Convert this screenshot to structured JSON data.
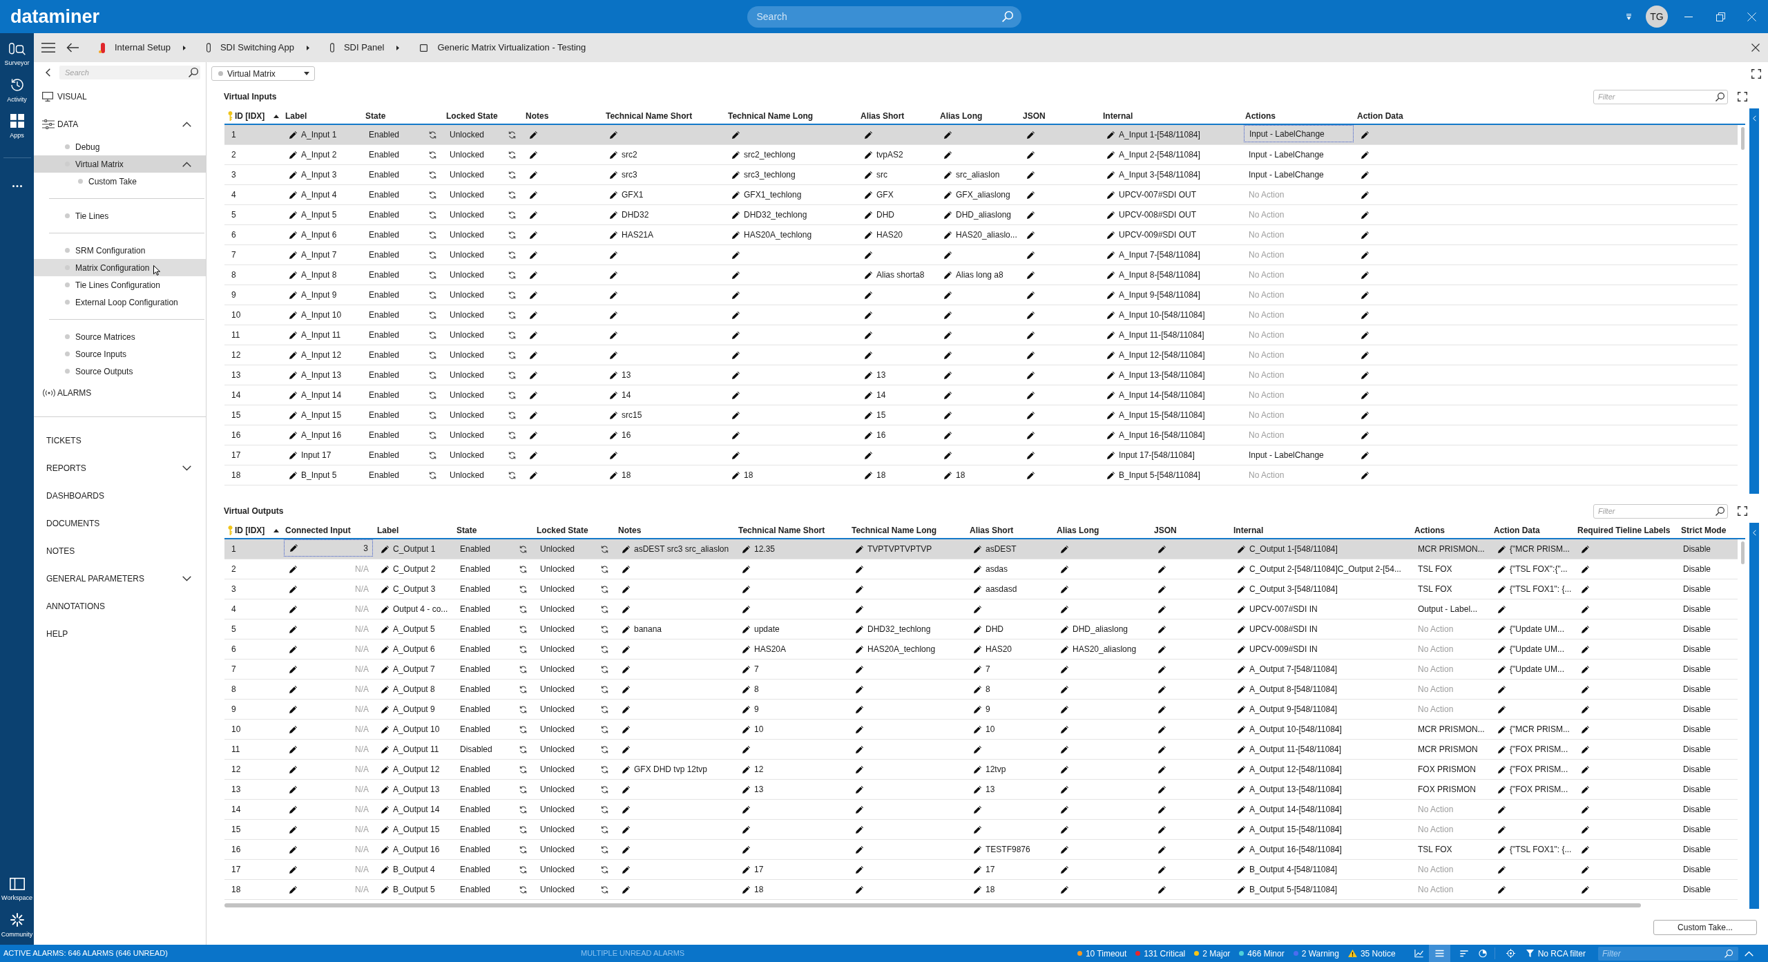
{
  "top_bar": {
    "logo": "dataminer",
    "search": {
      "placeholder": "Search"
    },
    "user": {
      "initials": "TG"
    }
  },
  "rail": {
    "items": [
      {
        "label": "Surveyor"
      },
      {
        "label": "Activity"
      },
      {
        "label": "Apps"
      }
    ],
    "bottom_items": [
      {
        "label": "Workspace"
      },
      {
        "label": "Community"
      }
    ]
  },
  "breadcrumb": [
    {
      "label": "Internal Setup",
      "kind": "view",
      "color": "#e0262b"
    },
    {
      "label": "SDI Switching App",
      "kind": "view"
    },
    {
      "label": "SDI Panel",
      "kind": "view"
    },
    {
      "label": "Generic Matrix Virtualization - Testing",
      "kind": "card"
    }
  ],
  "nav": {
    "search": {
      "placeholder": "Search"
    },
    "modules": [
      {
        "label": "VISUAL",
        "kind": "visual"
      },
      {
        "label": "DATA",
        "kind": "data",
        "expanded": true,
        "groups": [
          {
            "children": [
              {
                "label": "Debug",
                "selected": false,
                "hovered": false
              },
              {
                "label": "Virtual Matrix",
                "selected": true,
                "hovered": false,
                "expanded": true,
                "children": [
                  {
                    "label": "Custom Take",
                    "selected": false,
                    "hovered": false
                  }
                ]
              }
            ]
          },
          {
            "children": [
              {
                "label": "Tie Lines",
                "selected": false,
                "hovered": false
              }
            ]
          },
          {
            "children": [
              {
                "label": "SRM Configuration",
                "selected": false,
                "hovered": false
              },
              {
                "label": "Matrix Configuration",
                "selected": false,
                "hovered": true
              },
              {
                "label": "Tie Lines Configuration",
                "selected": false,
                "hovered": false
              },
              {
                "label": "External Loop Configuration",
                "selected": false,
                "hovered": false
              }
            ]
          },
          {
            "children": [
              {
                "label": "Source Matrices",
                "selected": false,
                "hovered": false
              },
              {
                "label": "Source Inputs",
                "selected": false,
                "hovered": false
              },
              {
                "label": "Source Outputs",
                "selected": false,
                "hovered": false
              }
            ]
          }
        ]
      },
      {
        "label": "ALARMS",
        "kind": "alarms"
      }
    ],
    "apps": [
      {
        "label": "TICKETS",
        "kind": "link"
      },
      {
        "label": "REPORTS",
        "kind": "menu",
        "expanded": false
      },
      {
        "label": "DASHBOARDS",
        "kind": "link"
      },
      {
        "label": "DOCUMENTS",
        "kind": "link"
      },
      {
        "label": "NOTES",
        "kind": "link"
      },
      {
        "label": "GENERAL PARAMETERS",
        "kind": "menu",
        "expanded": false
      },
      {
        "label": "ANNOTATIONS",
        "kind": "link"
      },
      {
        "label": "HELP",
        "kind": "link"
      }
    ]
  },
  "view_selector": {
    "value": "Virtual Matrix"
  },
  "tables": [
    {
      "title": "Virtual Inputs",
      "filter": {
        "placeholder": "Filter"
      },
      "columns": [
        {
          "label": "ID [IDX]",
          "kind": "key",
          "sorted": true,
          "focused": false
        },
        {
          "label": "Label",
          "kind": "edit",
          "sorted": false,
          "focused": false
        },
        {
          "label": "State",
          "kind": "toggle",
          "sorted": false,
          "focused": false
        },
        {
          "label": "Locked State",
          "kind": "toggle",
          "sorted": false,
          "focused": false
        },
        {
          "label": "Notes",
          "kind": "edit",
          "sorted": false,
          "focused": false
        },
        {
          "label": "Technical Name Short",
          "kind": "edit",
          "sorted": false,
          "focused": false
        },
        {
          "label": "Technical Name Long",
          "kind": "edit",
          "sorted": false,
          "focused": false
        },
        {
          "label": "Alias Short",
          "kind": "edit",
          "sorted": false,
          "focused": false
        },
        {
          "label": "Alias Long",
          "kind": "edit",
          "sorted": false,
          "focused": false
        },
        {
          "label": "JSON",
          "kind": "edit",
          "sorted": false,
          "focused": false
        },
        {
          "label": "Internal",
          "kind": "edit",
          "sorted": false,
          "focused": false
        },
        {
          "label": "Actions",
          "kind": "action",
          "sorted": false,
          "focused": true
        },
        {
          "label": "Action Data",
          "kind": "edit",
          "sorted": false,
          "focused": false
        }
      ],
      "rows": [
        {
          "id": "1",
          "label": "A_Input 1",
          "state": "Enabled",
          "locked_state": "Unlocked",
          "internal": "A_Input 1-[548/11084]",
          "actions": {
            "text": "Input - LabelChange",
            "dimmed": false
          },
          "selected": true
        },
        {
          "id": "2",
          "label": "A_Input 2",
          "state": "Enabled",
          "locked_state": "Unlocked",
          "tech_short": "src2",
          "tech_long": "src2_techlong",
          "alias_short": "tvpAS2",
          "internal": "A_Input 2-[548/11084]",
          "actions": {
            "text": "Input - LabelChange",
            "dimmed": false
          },
          "selected": false
        },
        {
          "id": "3",
          "label": "A_Input 3",
          "state": "Enabled",
          "locked_state": "Unlocked",
          "tech_short": "src3",
          "tech_long": "src3_techlong",
          "alias_short": "src",
          "alias_long": "src_aliaslon",
          "internal": "A_Input 3-[548/11084]",
          "actions": {
            "text": "Input - LabelChange",
            "dimmed": false
          },
          "selected": false
        },
        {
          "id": "4",
          "label": "A_Input 4",
          "state": "Enabled",
          "locked_state": "Unlocked",
          "tech_short": "GFX1",
          "tech_long": "GFX1_techlong",
          "alias_short": "GFX",
          "alias_long": "GFX_aliaslong",
          "internal": "UPCV-007#SDI OUT",
          "actions": {
            "text": "No Action",
            "dimmed": true
          },
          "selected": false
        },
        {
          "id": "5",
          "label": "A_Input 5",
          "state": "Enabled",
          "locked_state": "Unlocked",
          "tech_short": "DHD32",
          "tech_long": "DHD32_techlong",
          "alias_short": "DHD",
          "alias_long": "DHD_aliaslong",
          "internal": "UPCV-008#SDI OUT",
          "actions": {
            "text": "No Action",
            "dimmed": true
          },
          "selected": false
        },
        {
          "id": "6",
          "label": "A_Input 6",
          "state": "Enabled",
          "locked_state": "Unlocked",
          "tech_short": "HAS21A",
          "tech_long": "HAS20A_techlong",
          "alias_short": "HAS20",
          "alias_long": "HAS20_aliaslo...",
          "internal": "UPCV-009#SDI OUT",
          "actions": {
            "text": "No Action",
            "dimmed": true
          },
          "selected": false
        },
        {
          "id": "7",
          "label": "A_Input 7",
          "state": "Enabled",
          "locked_state": "Unlocked",
          "internal": "A_Input 7-[548/11084]",
          "actions": {
            "text": "No Action",
            "dimmed": true
          },
          "selected": false
        },
        {
          "id": "8",
          "label": "A_Input 8",
          "state": "Enabled",
          "locked_state": "Unlocked",
          "alias_short": "Alias shorta8",
          "alias_long": "Alias long a8",
          "internal": "A_Input 8-[548/11084]",
          "actions": {
            "text": "No Action",
            "dimmed": true
          },
          "selected": false
        },
        {
          "id": "9",
          "label": "A_Input 9",
          "state": "Enabled",
          "locked_state": "Unlocked",
          "internal": "A_Input 9-[548/11084]",
          "actions": {
            "text": "No Action",
            "dimmed": true
          },
          "selected": false
        },
        {
          "id": "10",
          "label": "A_Input 10",
          "state": "Enabled",
          "locked_state": "Unlocked",
          "internal": "A_Input 10-[548/11084]",
          "actions": {
            "text": "No Action",
            "dimmed": true
          },
          "selected": false
        },
        {
          "id": "11",
          "label": "A_Input 11",
          "state": "Enabled",
          "locked_state": "Unlocked",
          "internal": "A_Input 11-[548/11084]",
          "actions": {
            "text": "No Action",
            "dimmed": true
          },
          "selected": false
        },
        {
          "id": "12",
          "label": "A_Input 12",
          "state": "Enabled",
          "locked_state": "Unlocked",
          "internal": "A_Input 12-[548/11084]",
          "actions": {
            "text": "No Action",
            "dimmed": true
          },
          "selected": false
        },
        {
          "id": "13",
          "label": "A_Input 13",
          "state": "Enabled",
          "locked_state": "Unlocked",
          "tech_short": "13",
          "alias_short": "13",
          "internal": "A_Input 13-[548/11084]",
          "actions": {
            "text": "No Action",
            "dimmed": true
          },
          "selected": false
        },
        {
          "id": "14",
          "label": "A_Input 14",
          "state": "Enabled",
          "locked_state": "Unlocked",
          "tech_short": "14",
          "alias_short": "14",
          "internal": "A_Input 14-[548/11084]",
          "actions": {
            "text": "No Action",
            "dimmed": true
          },
          "selected": false
        },
        {
          "id": "15",
          "label": "A_Input 15",
          "state": "Enabled",
          "locked_state": "Unlocked",
          "tech_short": "src15",
          "alias_short": "15",
          "internal": "A_Input 15-[548/11084]",
          "actions": {
            "text": "No Action",
            "dimmed": true
          },
          "selected": false
        },
        {
          "id": "16",
          "label": "A_Input 16",
          "state": "Enabled",
          "locked_state": "Unlocked",
          "tech_short": "16",
          "alias_short": "16",
          "internal": "A_Input 16-[548/11084]",
          "actions": {
            "text": "No Action",
            "dimmed": true
          },
          "selected": false
        },
        {
          "id": "17",
          "label": "Input 17",
          "state": "Enabled",
          "locked_state": "Unlocked",
          "internal": "Input 17-[548/11084]",
          "actions": {
            "text": "Input - LabelChange",
            "dimmed": false
          },
          "selected": false
        },
        {
          "id": "18",
          "label": "B_Input 5",
          "state": "Enabled",
          "locked_state": "Unlocked",
          "tech_short": "18",
          "tech_long": "18",
          "alias_short": "18",
          "alias_long": "18",
          "internal": "B_Input 5-[548/11084]",
          "actions": {
            "text": "No Action",
            "dimmed": true
          },
          "selected": false
        }
      ]
    },
    {
      "title": "Virtual Outputs",
      "filter": {
        "placeholder": "Filter"
      },
      "columns": [
        {
          "label": "ID [IDX]",
          "kind": "key",
          "sorted": true,
          "focused": false
        },
        {
          "label": "Connected Input",
          "kind": "link",
          "sorted": false,
          "focused": true
        },
        {
          "label": "Label",
          "kind": "edit",
          "sorted": false,
          "focused": false
        },
        {
          "label": "State",
          "kind": "toggle",
          "sorted": false,
          "focused": false
        },
        {
          "label": "Locked State",
          "kind": "toggle",
          "sorted": false,
          "focused": false
        },
        {
          "label": "Notes",
          "kind": "edit",
          "sorted": false,
          "focused": false
        },
        {
          "label": "Technical Name Short",
          "kind": "edit",
          "sorted": false,
          "focused": false
        },
        {
          "label": "Technical Name Long",
          "kind": "edit",
          "sorted": false,
          "focused": false
        },
        {
          "label": "Alias Short",
          "kind": "edit",
          "sorted": false,
          "focused": false
        },
        {
          "label": "Alias Long",
          "kind": "edit",
          "sorted": false,
          "focused": false
        },
        {
          "label": "JSON",
          "kind": "edit",
          "sorted": false,
          "focused": false
        },
        {
          "label": "Internal",
          "kind": "edit",
          "sorted": false,
          "focused": false
        },
        {
          "label": "Actions",
          "kind": "action",
          "sorted": false,
          "focused": false
        },
        {
          "label": "Action Data",
          "kind": "edit",
          "sorted": false,
          "focused": false
        },
        {
          "label": "Required Tieline Labels",
          "kind": "edit",
          "sorted": false,
          "focused": false
        },
        {
          "label": "Strict Mode",
          "kind": "text",
          "sorted": false,
          "focused": false
        }
      ],
      "rows": [
        {
          "id": "1",
          "connected_input": {
            "text": "3",
            "dimmed": false
          },
          "label": "C_Output 1",
          "state": "Enabled",
          "locked_state": "Unlocked",
          "notes": "asDEST src3 src_aliaslon",
          "tech_short": "12.35",
          "tech_long": "TVPTVPTVPTVP",
          "alias_short": "asDEST",
          "internal": "C_Output 1-[548/11084]",
          "actions": {
            "text": "MCR PRISMON...",
            "dimmed": false
          },
          "action_data": "{\"MCR PRISM...",
          "strict_mode": "Disable",
          "selected": true
        },
        {
          "id": "2",
          "connected_input": {
            "text": "N/A",
            "dimmed": true
          },
          "label": "C_Output 2",
          "state": "Enabled",
          "locked_state": "Unlocked",
          "alias_short": "asdas",
          "internal": "C_Output 2-[548/11084]C_Output 2-[54...",
          "actions": {
            "text": "TSL FOX",
            "dimmed": false
          },
          "action_data": "{\"TSL FOX\":{\"...",
          "strict_mode": "Disable",
          "selected": false
        },
        {
          "id": "3",
          "connected_input": {
            "text": "N/A",
            "dimmed": true
          },
          "label": "C_Output 3",
          "state": "Enabled",
          "locked_state": "Unlocked",
          "alias_short": "aasdasd",
          "internal": "C_Output 3-[548/11084]",
          "actions": {
            "text": "TSL FOX",
            "dimmed": false
          },
          "action_data": "{\"TSL FOX1\": {...",
          "strict_mode": "Disable",
          "selected": false
        },
        {
          "id": "4",
          "connected_input": {
            "text": "N/A",
            "dimmed": true
          },
          "label": "Output 4 - co...",
          "state": "Enabled",
          "locked_state": "Unlocked",
          "internal": "UPCV-007#SDI IN",
          "actions": {
            "text": "Output - Label...",
            "dimmed": false
          },
          "strict_mode": "Disable",
          "selected": false
        },
        {
          "id": "5",
          "connected_input": {
            "text": "N/A",
            "dimmed": true
          },
          "label": "A_Output 5",
          "state": "Enabled",
          "locked_state": "Unlocked",
          "notes": "banana",
          "tech_short": "update",
          "tech_long": "DHD32_techlong",
          "alias_short": "DHD",
          "alias_long": "DHD_aliaslong",
          "internal": "UPCV-008#SDI IN",
          "actions": {
            "text": "No Action",
            "dimmed": true
          },
          "action_data": "{\"Update UM...",
          "strict_mode": "Disable",
          "selected": false
        },
        {
          "id": "6",
          "connected_input": {
            "text": "N/A",
            "dimmed": true
          },
          "label": "A_Output 6",
          "state": "Enabled",
          "locked_state": "Unlocked",
          "tech_short": "HAS20A",
          "tech_long": "HAS20A_techlong",
          "alias_short": "HAS20",
          "alias_long": "HAS20_aliaslong",
          "internal": "UPCV-009#SDI IN",
          "actions": {
            "text": "No Action",
            "dimmed": true
          },
          "action_data": "{\"Update UM...",
          "strict_mode": "Disable",
          "selected": false
        },
        {
          "id": "7",
          "connected_input": {
            "text": "N/A",
            "dimmed": true
          },
          "label": "A_Output 7",
          "state": "Enabled",
          "locked_state": "Unlocked",
          "tech_short": "7",
          "alias_short": "7",
          "internal": "A_Output 7-[548/11084]",
          "actions": {
            "text": "No Action",
            "dimmed": true
          },
          "action_data": "{\"Update UM...",
          "strict_mode": "Disable",
          "selected": false
        },
        {
          "id": "8",
          "connected_input": {
            "text": "N/A",
            "dimmed": true
          },
          "label": "A_Output 8",
          "state": "Enabled",
          "locked_state": "Unlocked",
          "tech_short": "8",
          "alias_short": "8",
          "internal": "A_Output 8-[548/11084]",
          "actions": {
            "text": "No Action",
            "dimmed": true
          },
          "strict_mode": "Disable",
          "selected": false
        },
        {
          "id": "9",
          "connected_input": {
            "text": "N/A",
            "dimmed": true
          },
          "label": "A_Output 9",
          "state": "Enabled",
          "locked_state": "Unlocked",
          "tech_short": "9",
          "alias_short": "9",
          "internal": "A_Output 9-[548/11084]",
          "actions": {
            "text": "No Action",
            "dimmed": true
          },
          "strict_mode": "Disable",
          "selected": false
        },
        {
          "id": "10",
          "connected_input": {
            "text": "N/A",
            "dimmed": true
          },
          "label": "A_Output 10",
          "state": "Enabled",
          "locked_state": "Unlocked",
          "tech_short": "10",
          "alias_short": "10",
          "internal": "A_Output 10-[548/11084]",
          "actions": {
            "text": "MCR PRISMON...",
            "dimmed": false
          },
          "action_data": "{\"MCR PRISM...",
          "strict_mode": "Disable",
          "selected": false
        },
        {
          "id": "11",
          "connected_input": {
            "text": "N/A",
            "dimmed": true
          },
          "label": "A_Output 11",
          "state": "Disabled",
          "locked_state": "Unlocked",
          "internal": "A_Output 11-[548/11084]",
          "actions": {
            "text": "MCR PRISMON",
            "dimmed": false
          },
          "action_data": "{\"FOX PRISM...",
          "strict_mode": "Disable",
          "selected": false
        },
        {
          "id": "12",
          "connected_input": {
            "text": "N/A",
            "dimmed": true
          },
          "label": "A_Output 12",
          "state": "Enabled",
          "locked_state": "Unlocked",
          "notes": "GFX DHD tvp 12tvp",
          "tech_short": "12",
          "alias_short": "12tvp",
          "internal": "A_Output 12-[548/11084]",
          "actions": {
            "text": "FOX PRISMON",
            "dimmed": false
          },
          "action_data": "{\"FOX PRISM...",
          "strict_mode": "Disable",
          "selected": false
        },
        {
          "id": "13",
          "connected_input": {
            "text": "N/A",
            "dimmed": true
          },
          "label": "A_Output 13",
          "state": "Enabled",
          "locked_state": "Unlocked",
          "tech_short": "13",
          "alias_short": "13",
          "internal": "A_Output 13-[548/11084]",
          "actions": {
            "text": "FOX PRISMON",
            "dimmed": false
          },
          "action_data": "{\"FOX PRISM...",
          "strict_mode": "Disable",
          "selected": false
        },
        {
          "id": "14",
          "connected_input": {
            "text": "N/A",
            "dimmed": true
          },
          "label": "A_Output 14",
          "state": "Enabled",
          "locked_state": "Unlocked",
          "internal": "A_Output 14-[548/11084]",
          "actions": {
            "text": "No Action",
            "dimmed": true
          },
          "strict_mode": "Disable",
          "selected": false
        },
        {
          "id": "15",
          "connected_input": {
            "text": "N/A",
            "dimmed": true
          },
          "label": "A_Output 15",
          "state": "Enabled",
          "locked_state": "Unlocked",
          "internal": "A_Output 15-[548/11084]",
          "actions": {
            "text": "No Action",
            "dimmed": true
          },
          "strict_mode": "Disable",
          "selected": false
        },
        {
          "id": "16",
          "connected_input": {
            "text": "N/A",
            "dimmed": true
          },
          "label": "A_Output 16",
          "state": "Enabled",
          "locked_state": "Unlocked",
          "alias_short": "TESTF9876",
          "internal": "A_Output 16-[548/11084]",
          "actions": {
            "text": "TSL FOX",
            "dimmed": false
          },
          "action_data": "{\"TSL FOX1\": {...",
          "strict_mode": "Disable",
          "selected": false
        },
        {
          "id": "17",
          "connected_input": {
            "text": "N/A",
            "dimmed": true
          },
          "label": "B_Output 4",
          "state": "Enabled",
          "locked_state": "Unlocked",
          "tech_short": "17",
          "alias_short": "17",
          "internal": "B_Output 4-[548/11084]",
          "actions": {
            "text": "No Action",
            "dimmed": true
          },
          "strict_mode": "Disable",
          "selected": false
        },
        {
          "id": "18",
          "connected_input": {
            "text": "N/A",
            "dimmed": true
          },
          "label": "B_Output 5",
          "state": "Enabled",
          "locked_state": "Unlocked",
          "tech_short": "18",
          "alias_short": "18",
          "internal": "B_Output 5-[548/11084]",
          "actions": {
            "text": "No Action",
            "dimmed": true
          },
          "strict_mode": "Disable",
          "selected": false
        }
      ]
    }
  ],
  "custom_take_button": "Custom Take...",
  "status_bar": {
    "summary": "ACTIVE ALARMS: 646 ALARMS (646 UNREAD)",
    "notice": "MULTIPLE UNREAD ALARMS",
    "counters": [
      {
        "label": "10 Timeout",
        "kind": "dot",
        "color": "#f59a23"
      },
      {
        "label": "131 Critical",
        "kind": "dot",
        "color": "#e8262b"
      },
      {
        "label": "2 Major",
        "kind": "dot",
        "color": "#f5c518"
      },
      {
        "label": "466 Minor",
        "kind": "dot",
        "color": "#4fd1d9"
      },
      {
        "label": "2 Warning",
        "kind": "dot",
        "color": "#4b6cf0"
      },
      {
        "label": "35 Notice",
        "kind": "triangle",
        "color": "#f7c51e"
      }
    ],
    "view_modes": [
      {
        "selected": false
      },
      {
        "selected": true
      },
      {
        "selected": false
      },
      {
        "selected": false
      }
    ],
    "rca_filter": "No RCA filter",
    "filter": {
      "placeholder": "Filter"
    }
  }
}
